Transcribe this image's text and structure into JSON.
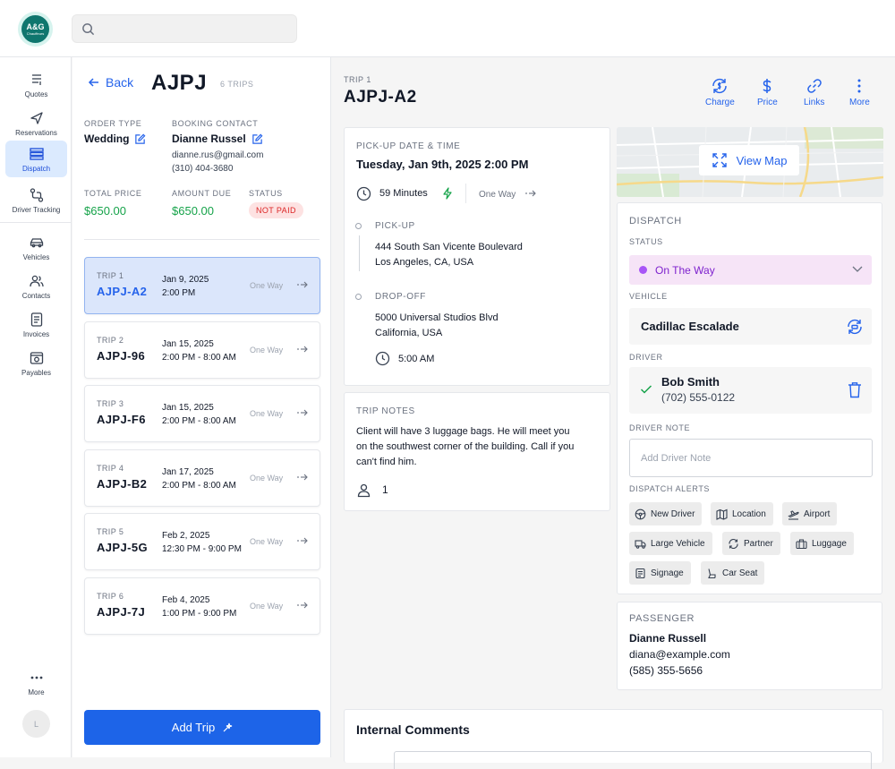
{
  "app": {
    "logo_line1": "A&G",
    "logo_line2": "Chauffeurs"
  },
  "search": {
    "placeholder": ""
  },
  "nav": {
    "items": [
      {
        "label": "Quotes"
      },
      {
        "label": "Reservations"
      },
      {
        "label": "Dispatch"
      },
      {
        "label": "Driver Tracking"
      },
      {
        "label": "Vehicles"
      },
      {
        "label": "Contacts"
      },
      {
        "label": "Invoices"
      },
      {
        "label": "Payables"
      }
    ],
    "more": "More",
    "avatar": "L"
  },
  "order": {
    "back": "Back",
    "id": "AJPJ",
    "trips_count": "6 TRIPS",
    "order_type_label": "ORDER TYPE",
    "order_type": "Wedding",
    "booking_contact_label": "BOOKING CONTACT",
    "contact_name": "Dianne Russel",
    "contact_email": "dianne.rus@gmail.com",
    "contact_phone": "(310) 404-3680",
    "total_price_label": "TOTAL PRICE",
    "total_price": "$650.00",
    "amount_due_label": "AMOUNT DUE",
    "amount_due": "$650.00",
    "status_label": "STATUS",
    "status": "NOT PAID"
  },
  "trips": [
    {
      "num": "TRIP 1",
      "id": "AJPJ-A2",
      "date": "Jan 9, 2025",
      "time": "2:00 PM",
      "way": "One Way"
    },
    {
      "num": "TRIP 2",
      "id": "AJPJ-96",
      "date": "Jan 15, 2025",
      "time": "2:00 PM - 8:00 AM",
      "way": "One Way"
    },
    {
      "num": "TRIP 3",
      "id": "AJPJ-F6",
      "date": "Jan 15, 2025",
      "time": "2:00 PM - 8:00 AM",
      "way": "One Way"
    },
    {
      "num": "TRIP 4",
      "id": "AJPJ-B2",
      "date": "Jan 17, 2025",
      "time": "2:00 PM - 8:00 AM",
      "way": "One Way"
    },
    {
      "num": "TRIP 5",
      "id": "AJPJ-5G",
      "date": "Feb 2, 2025",
      "time": "12:30 PM - 9:00 PM",
      "way": "One Way"
    },
    {
      "num": "TRIP 6",
      "id": "AJPJ-7J",
      "date": "Feb 4, 2025",
      "time": "1:00 PM - 9:00 PM",
      "way": "One Way"
    }
  ],
  "add_trip": "Add Trip",
  "trip": {
    "label": "TRIP 1",
    "title": "AJPJ-A2",
    "actions": [
      "Charge",
      "Price",
      "Links",
      "More"
    ],
    "pickup_dt_label": "PICK-UP DATE & TIME",
    "pickup_dt": "Tuesday, Jan 9th, 2025 2:00 PM",
    "duration": "59 Minutes",
    "way": "One Way",
    "pickup_label": "PICK-UP",
    "pickup_line1": "444 South San Vicente Boulevard",
    "pickup_line2": "Los Angeles, CA, USA",
    "dropoff_label": "DROP-OFF",
    "dropoff_line1": "5000 Universal Studios Blvd",
    "dropoff_line2": "California, USA",
    "dropoff_time": "5:00 AM",
    "notes_label": "TRIP NOTES",
    "notes": "Client will have 3 luggage bags. He will meet you on the southwest corner of the building. Call if you can't find him.",
    "passenger_count": "1"
  },
  "map": {
    "view_label": "View Map"
  },
  "dispatch": {
    "title": "DISPATCH",
    "status_label": "STATUS",
    "status": "On The Way",
    "vehicle_label": "VEHICLE",
    "vehicle": "Cadillac Escalade",
    "driver_label": "DRIVER",
    "driver_name": "Bob Smith",
    "driver_phone": "(702) 555-0122",
    "driver_note_label": "DRIVER NOTE",
    "driver_note_placeholder": "Add Driver Note",
    "alerts_label": "DISPATCH ALERTS",
    "alerts": [
      "New Driver",
      "Location",
      "Airport",
      "Large Vehicle",
      "Partner",
      "Luggage",
      "Signage",
      "Car Seat"
    ]
  },
  "passenger": {
    "label": "PASSENGER",
    "name": "Dianne Russell",
    "email": "diana@example.com",
    "phone": "(585) 355-5656"
  },
  "comments": {
    "title": "Internal Comments"
  },
  "colors": {
    "primary": "#1d64e8",
    "success": "#16a34a",
    "danger": "#dc2626",
    "status": "#a855f7"
  }
}
